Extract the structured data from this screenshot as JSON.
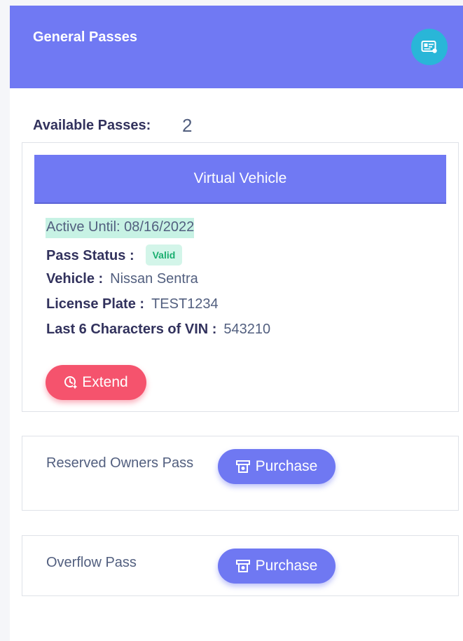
{
  "header": {
    "title": "General Passes",
    "icon": "pass-card-icon",
    "accent_color": "#7079f3",
    "icon_bg_color": "#29b6d8"
  },
  "available": {
    "label": "Available Passes:",
    "count": "2"
  },
  "active_pass": {
    "title": "Virtual Vehicle",
    "active_until": "Active Until: 08/16/2022",
    "status_label": "Pass Status :",
    "status_value": "Valid",
    "vehicle_label": "Vehicle :",
    "vehicle_value": "Nissan Sentra",
    "plate_label": "License Plate :",
    "plate_value": "TEST1234",
    "vin_label": "Last 6 Characters of VIN :",
    "vin_value": "543210",
    "extend_label": "Extend",
    "extend_icon": "clock-plus-icon",
    "extend_color": "#f5536d"
  },
  "other_passes": [
    {
      "name": "Reserved Owners Pass",
      "button_label": "Purchase",
      "button_icon": "ticket-icon"
    },
    {
      "name": "Overflow Pass",
      "button_label": "Purchase",
      "button_icon": "ticket-icon"
    }
  ]
}
